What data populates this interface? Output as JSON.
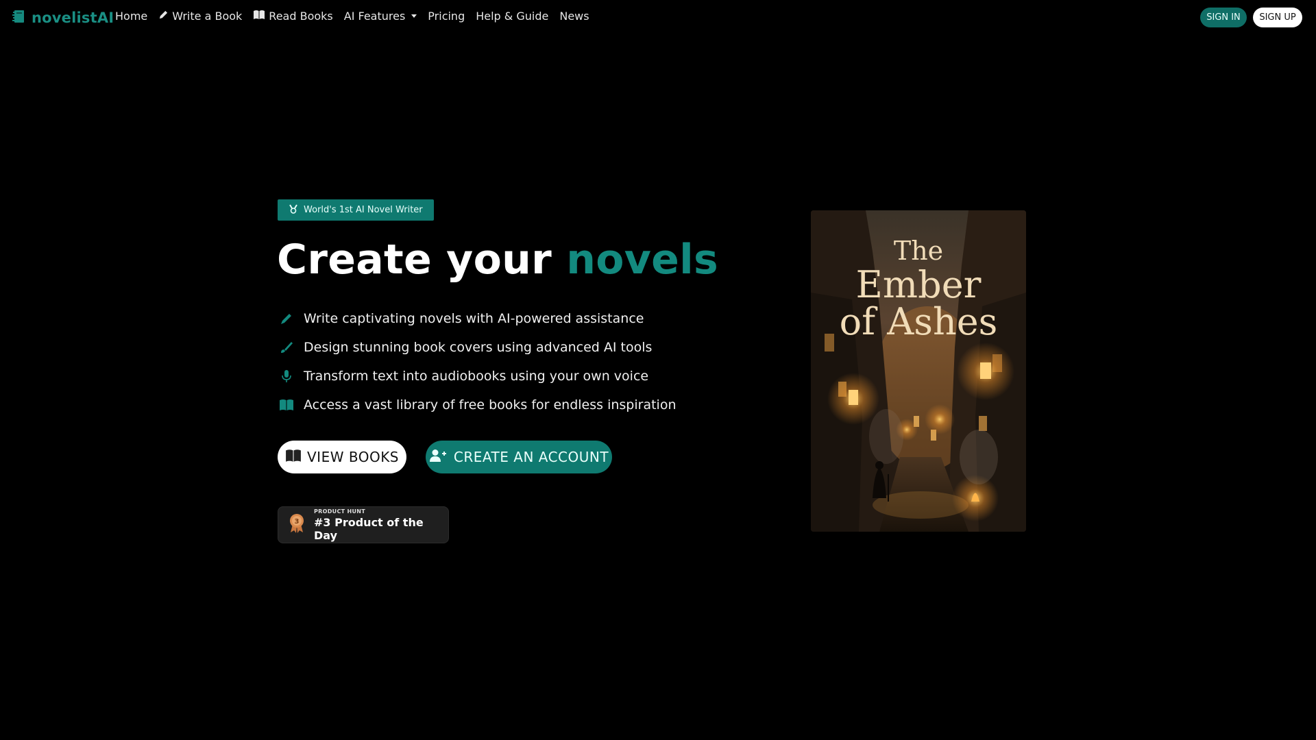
{
  "nav": {
    "brand": "novelistAI",
    "links": [
      "Home",
      "Write a Book",
      "Read Books",
      "AI Features",
      "Pricing",
      "Help & Guide",
      "News"
    ],
    "signin": "SIGN IN",
    "signup": "SIGN UP"
  },
  "hero": {
    "badge": "World's 1st AI Novel Writer",
    "title_part1": "Create your",
    "title_accent": "novels",
    "features": [
      "Write captivating novels with AI-powered assistance",
      "Design stunning book covers using advanced AI tools",
      "Transform text into audiobooks using your own voice",
      "Access a vast library of free books for endless inspiration"
    ],
    "view_books": "VIEW BOOKS",
    "create_account": "CREATE AN ACCOUNT",
    "producthunt": {
      "label": "PRODUCT HUNT",
      "rank_text": "#3 Product of the Day",
      "medal_number": "3"
    }
  },
  "cover": {
    "line1": "The",
    "line2": "Ember",
    "line3": "of Ashes"
  },
  "colors": {
    "accent": "#138a7f",
    "background": "#000000"
  }
}
